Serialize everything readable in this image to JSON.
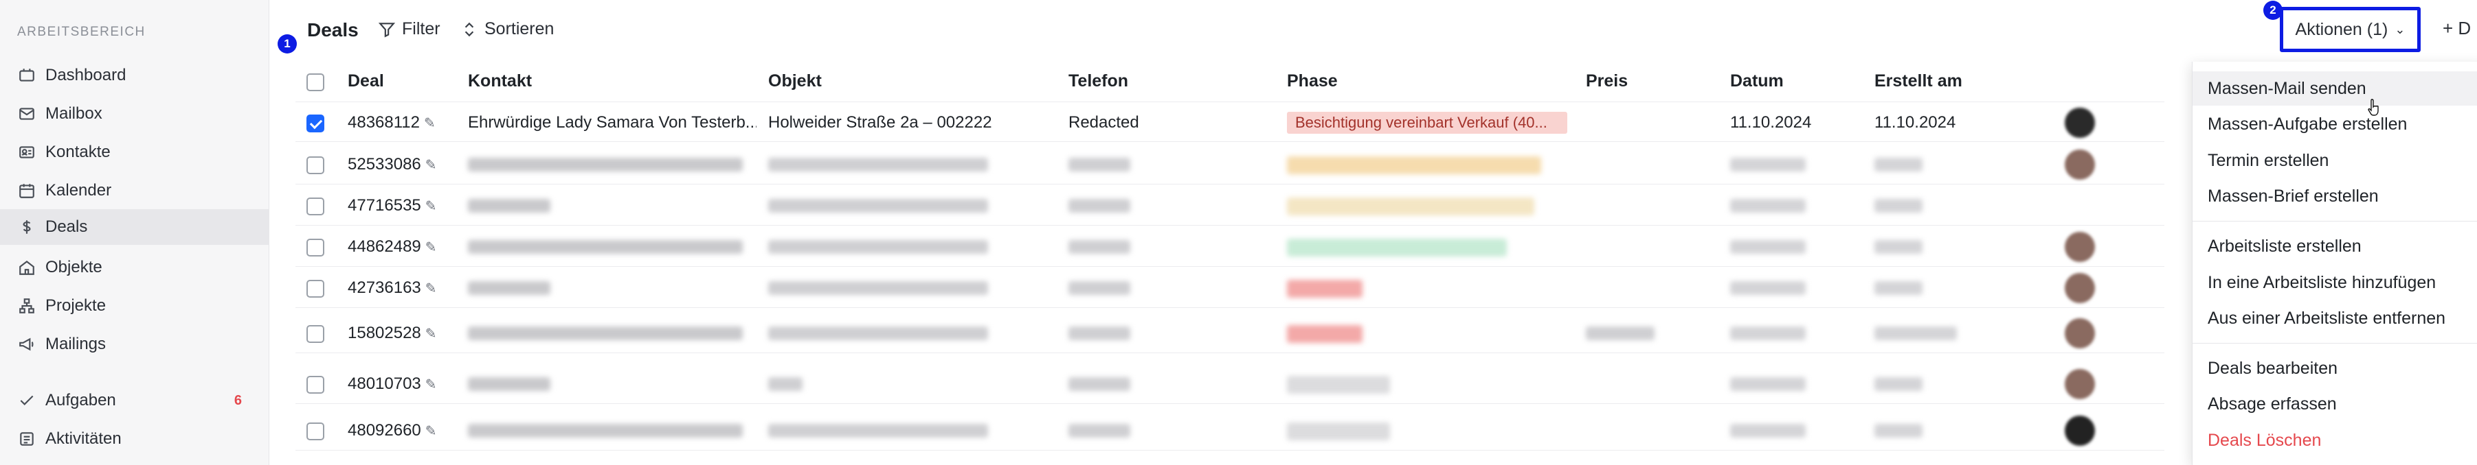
{
  "sidebar": {
    "section_label": "ARBEITSBEREICH",
    "items": [
      {
        "label": "Dashboard",
        "icon": "grid-icon"
      },
      {
        "label": "Mailbox",
        "icon": "mail-icon"
      },
      {
        "label": "Kontakte",
        "icon": "contact-card-icon"
      },
      {
        "label": "Kalender",
        "icon": "calendar-icon"
      },
      {
        "label": "Deals",
        "icon": "dollar-icon"
      },
      {
        "label": "Objekte",
        "icon": "house-icon"
      },
      {
        "label": "Projekte",
        "icon": "network-icon"
      },
      {
        "label": "Mailings",
        "icon": "megaphone-icon"
      },
      {
        "label": "Aufgaben",
        "icon": "check-icon",
        "badge": "6"
      },
      {
        "label": "Aktivitäten",
        "icon": "list-icon"
      }
    ]
  },
  "toolbar": {
    "title": "Deals",
    "filter_label": "Filter",
    "sort_label": "Sortieren",
    "actions_label": "Aktionen (1)",
    "add_label": "+ D"
  },
  "markers": {
    "checkbox_column": "1",
    "actions_button": "2"
  },
  "table": {
    "columns": [
      "Deal",
      "Kontakt",
      "Objekt",
      "Telefon",
      "Phase",
      "Preis",
      "Datum",
      "Erstellt am"
    ],
    "rows": [
      {
        "deal": "48368112",
        "kontakt": "Ehrwürdige Lady Samara Von Testerb...",
        "objekt": "Holweider Straße 2a – 002222",
        "telefon": "Redacted",
        "phase": "Besichtigung vereinbart Verkauf (40...",
        "preis": "",
        "datum": "11.10.2024",
        "erstellt": "11.10.2024",
        "checked": true
      },
      {
        "deal": "52533086",
        "checked": false
      },
      {
        "deal": "47716535",
        "checked": false
      },
      {
        "deal": "44862489",
        "checked": false
      },
      {
        "deal": "42736163",
        "checked": false
      },
      {
        "deal": "15802528",
        "checked": false
      },
      {
        "deal": "48010703",
        "checked": false
      },
      {
        "deal": "48092660",
        "checked": false
      }
    ]
  },
  "menu": {
    "group1": [
      "Massen-Mail senden",
      "Massen-Aufgabe erstellen",
      "Termin erstellen",
      "Massen-Brief erstellen"
    ],
    "group2": [
      "Arbeitsliste erstellen",
      "In eine Arbeitsliste hinzufügen",
      "Aus einer Arbeitsliste entfernen"
    ],
    "group3": [
      "Deals bearbeiten",
      "Absage erfassen",
      "Deals Löschen"
    ]
  },
  "colors": {
    "accent": "#1a66ff",
    "annotation": "#0d1ce3",
    "danger": "#e5484d",
    "phase_red_bg": "#f9d3d0"
  }
}
